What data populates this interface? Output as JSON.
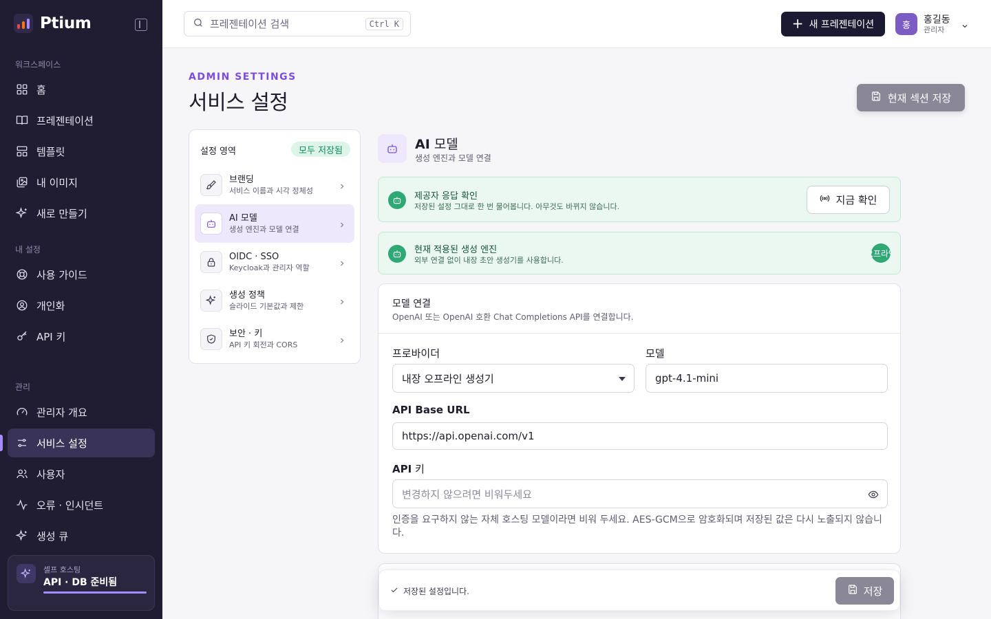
{
  "brand": {
    "name": "Ptium",
    "logo_colors": [
      "#a78bfa",
      "#f97316",
      "#ef4444"
    ]
  },
  "sidebar": {
    "sections": [
      {
        "label": "워크스페이스"
      },
      {
        "label": "내 설정"
      },
      {
        "label": "관리"
      }
    ],
    "items": [
      {
        "label": "홈",
        "icon": "grid-icon"
      },
      {
        "label": "프레젠테이션",
        "icon": "book-icon"
      },
      {
        "label": "템플릿",
        "icon": "layout-icon"
      },
      {
        "label": "내 이미지",
        "icon": "image-icon"
      },
      {
        "label": "새로 만들기",
        "icon": "sparkles-icon"
      },
      {
        "label": "사용 가이드",
        "icon": "lifebuoy-icon"
      },
      {
        "label": "개인화",
        "icon": "user-circle-icon"
      },
      {
        "label": "API 키",
        "icon": "key-icon"
      },
      {
        "label": "관리자 개요",
        "icon": "gauge-icon"
      },
      {
        "label": "서비스 설정",
        "icon": "sliders-icon",
        "active": true
      },
      {
        "label": "사용자",
        "icon": "users-icon"
      },
      {
        "label": "오류 · 인시던트",
        "icon": "activity-icon"
      },
      {
        "label": "생성 큐",
        "icon": "sparkles-icon"
      }
    ],
    "self_host": {
      "label": "셀프 호스팅",
      "title": "API · DB 준비됨"
    }
  },
  "topbar": {
    "search_placeholder": "프레젠테이션 검색",
    "shortcut": "Ctrl K",
    "new_button": "새 프레젠테이션",
    "user": {
      "initial": "홍",
      "name": "홍길동",
      "role": "관리자"
    }
  },
  "header": {
    "eyebrow": "ADMIN SETTINGS",
    "title": "서비스 설정",
    "save_section": "현재 섹션 저장"
  },
  "settings_areas": {
    "title": "설정 영역",
    "badge": "모두 저장됨",
    "items": [
      {
        "label": "브랜딩",
        "desc": "서비스 이름과 시각 정체성",
        "icon": "brush-icon"
      },
      {
        "label": "AI 모델",
        "desc": "생성 엔진과 모델 연결",
        "icon": "bot-icon",
        "active": true
      },
      {
        "label": "OIDC · SSO",
        "desc": "Keycloak과 관리자 역할",
        "icon": "lock-icon"
      },
      {
        "label": "생성 정책",
        "desc": "슬라이드 기본값과 제한",
        "icon": "sparkles-icon"
      },
      {
        "label": "보안 · 키",
        "desc": "API 키 회전과 CORS",
        "icon": "shield-icon"
      }
    ]
  },
  "section": {
    "title_bold": "AI",
    "title_rest": " 모델",
    "desc": "생성 엔진과 모델 연결"
  },
  "provider_check": {
    "title": "제공자 응답 확인",
    "desc": "저장된 설정 그대로 한 번 물어봅니다. 아무것도 바뀌지 않습니다.",
    "button": "지금 확인"
  },
  "engine": {
    "title": "현재 적용된 생성 엔진",
    "desc": "외부 연결 없이 내장 초안 생성기를 사용합니다.",
    "badge": "오프라인"
  },
  "model_connection": {
    "title": "모델 연결",
    "desc": "OpenAI 또는 OpenAI 호환 Chat Completions API를 연결합니다.",
    "provider_label": "프로바이더",
    "provider_value": "내장 오프라인 생성기",
    "model_label": "모델",
    "model_value": "gpt-4.1-mini",
    "base_url_label": "API Base URL",
    "base_url_value": "https://api.openai.com/v1",
    "api_key_label_bold": "API",
    "api_key_label_rest": " 키",
    "api_key_placeholder": "변경하지 않으려면 비워두세요",
    "help": "인증을 요구하지 않는 자체 호스팅 모델이라면 비워 두세요. AES-GCM으로 암호화되며 저장된 값은 다시 노출되지 않습니다."
  },
  "save_bar": {
    "status": "저장된 설정입니다.",
    "button": "저장"
  }
}
